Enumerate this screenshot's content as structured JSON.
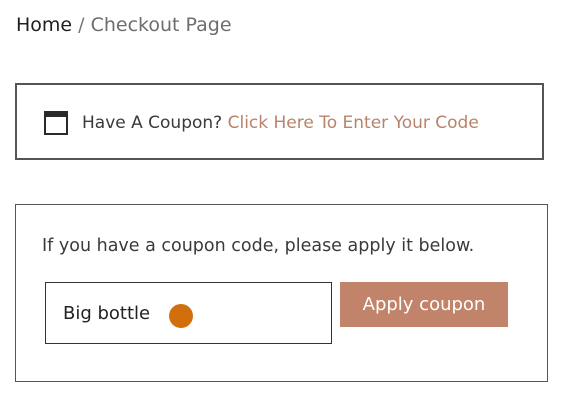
{
  "breadcrumb": {
    "home": "Home",
    "separator": " / ",
    "current": "Checkout Page"
  },
  "coupon_notice": {
    "text": "Have A Coupon? ",
    "link": "Click Here To Enter Your Code",
    "icon": "window-icon"
  },
  "coupon_form": {
    "prompt": "If you have a coupon code, please apply it below.",
    "input_value": "Big bottle",
    "button_label": "Apply coupon"
  },
  "colors": {
    "accent": "#c18369",
    "link": "#b8836a",
    "cursor_marker": "#d16f0d"
  }
}
